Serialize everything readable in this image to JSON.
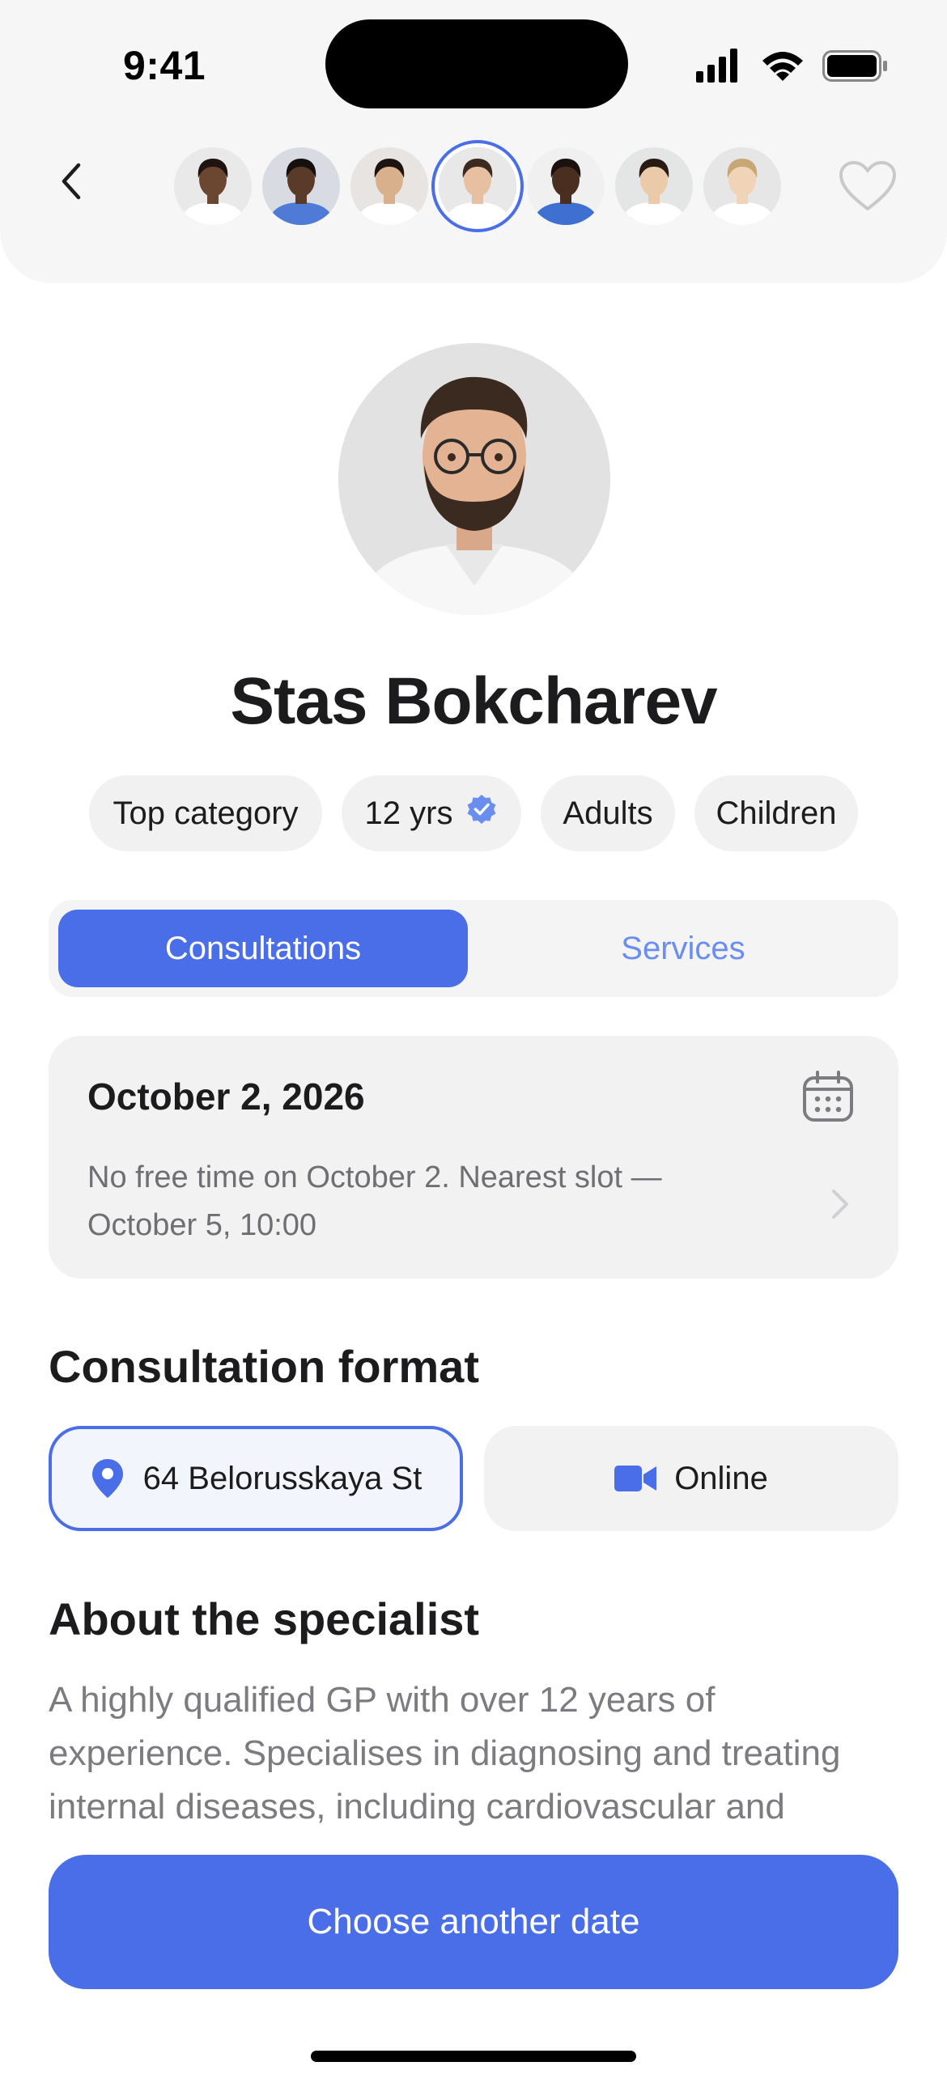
{
  "status_bar": {
    "time": "9:41"
  },
  "doctors": [
    {
      "name": "doctor-1",
      "skin": "#6b4630",
      "hair": "#1f1410",
      "coat": "#ffffff",
      "bg": "#e9e9e9",
      "active": false
    },
    {
      "name": "doctor-2",
      "skin": "#5a3a28",
      "hair": "#161010",
      "coat": "#4f7bd6",
      "bg": "#d8dce2",
      "active": false
    },
    {
      "name": "doctor-3",
      "skin": "#d8b08c",
      "hair": "#1c1410",
      "coat": "#ffffff",
      "bg": "#e8e4e2",
      "active": false
    },
    {
      "name": "doctor-4",
      "skin": "#e6c0a0",
      "hair": "#3a2a20",
      "coat": "#ffffff",
      "bg": "#e8e8e8",
      "active": true
    },
    {
      "name": "doctor-5",
      "skin": "#4a2e20",
      "hair": "#1a1210",
      "coat": "#3f6fd0",
      "bg": "#f0f0f0",
      "active": false
    },
    {
      "name": "doctor-6",
      "skin": "#eacaa8",
      "hair": "#2a1c14",
      "coat": "#ffffff",
      "bg": "#e4e6e6",
      "active": false
    },
    {
      "name": "doctor-7",
      "skin": "#f0d4b8",
      "hair": "#c9a676",
      "coat": "#ffffff",
      "bg": "#e6e6e6",
      "active": false
    }
  ],
  "profile": {
    "name": "Stas Bokcharev",
    "tags": [
      {
        "label": "Top category"
      },
      {
        "label": "12 yrs",
        "verified": true
      },
      {
        "label": "Adults"
      },
      {
        "label": "Children"
      }
    ]
  },
  "tabs": {
    "consultations": "Consultations",
    "services": "Services"
  },
  "date_card": {
    "title": "October 2, 2026",
    "subtitle": "No free time on October 2. Nearest slot — October 5, 10:00"
  },
  "format": {
    "title": "Consultation format",
    "address": "64 Belorusskaya St",
    "online": "Online"
  },
  "about": {
    "title": "About the specialist",
    "text": "A highly qualified GP with over 12 years of experience. Specialises in diagnosing and treating internal diseases, including cardiovascular and respiratory conditions."
  },
  "cta": {
    "label": "Choose another date"
  },
  "colors": {
    "accent": "#4a6ee8",
    "accent_light": "#6a8df0",
    "chip_bg": "#f1f1f1"
  }
}
